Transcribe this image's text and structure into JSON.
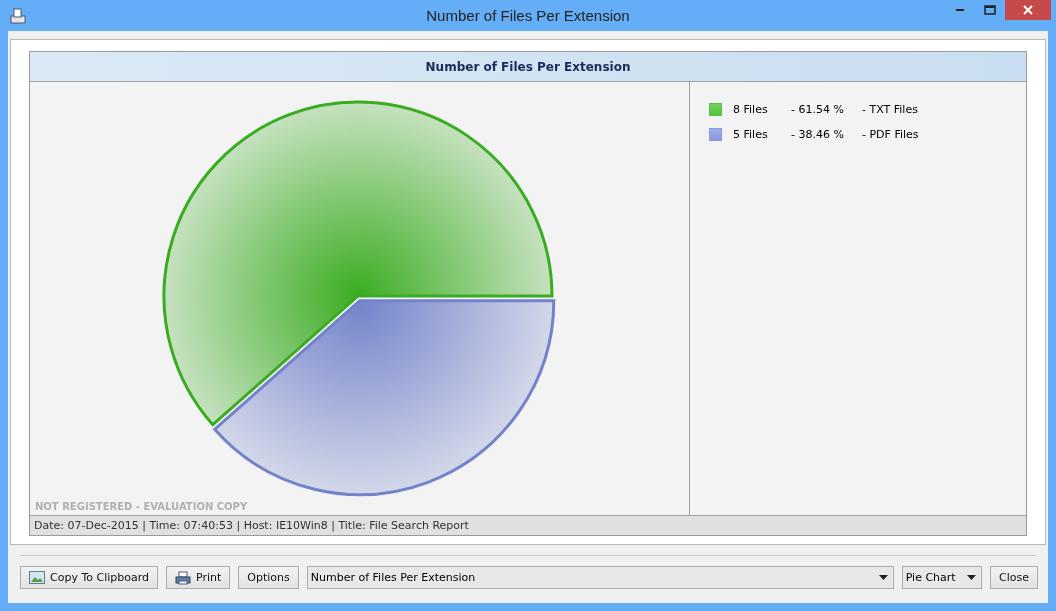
{
  "window": {
    "title": "Number of Files Per Extension"
  },
  "report": {
    "title": "Number of Files Per Extension",
    "chart_data": {
      "type": "pie",
      "values": [
        61.54,
        38.46
      ]
    },
    "legend": [
      {
        "count": "8 Files",
        "percent": "- 61.54 %",
        "name": "- TXT Files",
        "color": "#55c43c"
      },
      {
        "count": "5 Files",
        "percent": "- 38.46 %",
        "name": "- PDF Files",
        "color": "#8a9ae0"
      }
    ],
    "notice": "NOT REGISTERED - EVALUATION COPY",
    "status": "Date: 07-Dec-2015 | Time: 07:40:53 | Host: IE10Win8 | Title: File Search Report"
  },
  "toolbar": {
    "copy_button": "Copy To Clipboard",
    "print_button": "Print",
    "options_button": "Options",
    "report_select": "Number of Files Per Extension",
    "chart_select": "Pie Chart",
    "close_button": "Close"
  }
}
